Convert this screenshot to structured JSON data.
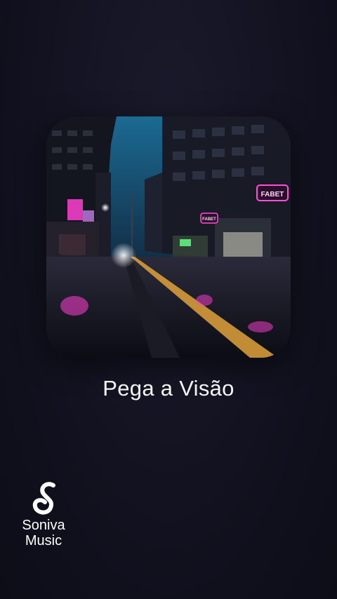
{
  "song": {
    "title": "Pega a Visão",
    "cover_signs": [
      "FABET",
      "FABET"
    ]
  },
  "brand": {
    "name": "Soniva\nMusic",
    "icon": "music-note-s-icon"
  },
  "colors": {
    "background": "#121220",
    "title_text": "#f4f4f7",
    "neon_pink": "#ff4fd8",
    "road_line": "#e0a23a",
    "sky": "#1f5f86"
  }
}
